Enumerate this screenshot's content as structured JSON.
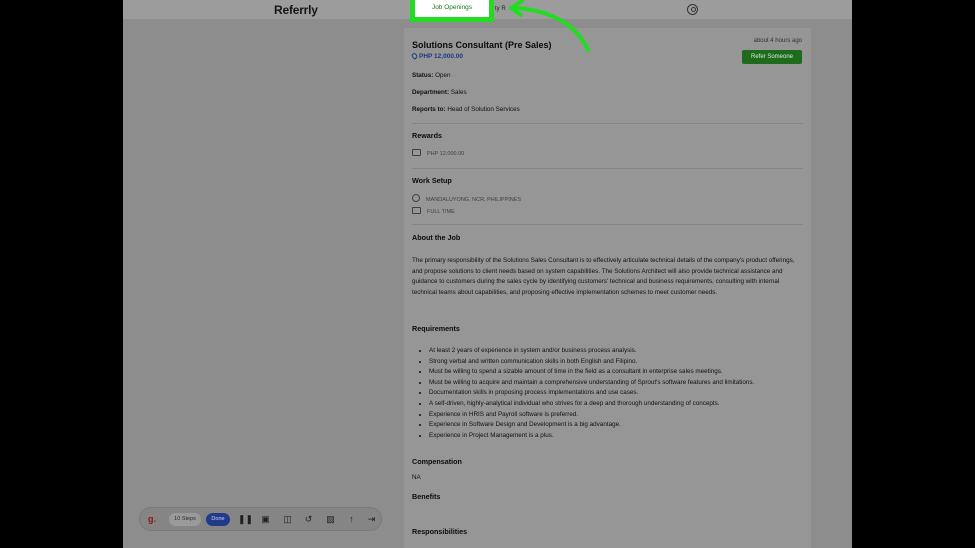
{
  "app": {
    "brand": "Referrly",
    "nav_partial": "ty R"
  },
  "highlight": {
    "label": "Job Openings",
    "color": "#22dc22"
  },
  "job": {
    "posted": "about 4 hours ago",
    "refer_label": "Refer Someone",
    "title": "Solutions Consultant (Pre Sales)",
    "salary": "PHP 12,000.00",
    "status_label": "Status:",
    "status_value": "Open",
    "department_label": "Department:",
    "department_value": "Sales",
    "reports_label": "Reports to:",
    "reports_value": "Head of Solution Services"
  },
  "rewards": {
    "heading": "Rewards",
    "value": "PHP 12,000.00"
  },
  "work_setup": {
    "heading": "Work Setup",
    "location": "MANDALUYONG, NCR, PHILIPPINES",
    "type": "FULL TIME"
  },
  "about": {
    "heading": "About the Job",
    "text": "The primary responsibility of the Solutions Sales Consultant is to effectively articulate technical details of the company's product offerings, and propose solutions to client needs based on system capabilities. The Solutions Architect will also provide technical assistance and guidance to customers during the sales cycle by identifying customers' technical and business requirements, consulting with internal technical teams about capabilities, and proposing effective implementation schemes to meet customer needs."
  },
  "requirements": {
    "heading": "Requirements",
    "items": [
      "At least 2 years of experience in system and/or business process analysis.",
      "Strong verbal and written communication skills in both English and Filipino.",
      "Must be willing to spend a sizable amount of time in the field as a consultant in enterprise sales meetings.",
      "Must be willing to acquire and maintain a comprehensive understanding of Sprout's software features and limitations.",
      "Documentation skills in proposing process implementations and use cases.",
      "A self-driven, highly-analytical individual who strives for a deep and thorough understanding of concepts.",
      "Experience in HRIS and Payroll software is preferred.",
      "Experience in Software Design and Development is a big advantage.",
      "Experience in Project Management is a plus."
    ]
  },
  "compensation": {
    "heading": "Compensation",
    "value": "NA"
  },
  "benefits": {
    "heading": "Benefits"
  },
  "responsibilities": {
    "heading": "Responsibilities"
  },
  "toolbar": {
    "logo": "g.",
    "steps_label": "10 Steps",
    "done_label": "Done",
    "icons": [
      "pause-icon",
      "stop-icon",
      "image-icon",
      "undo-icon",
      "trash-icon",
      "upload-icon",
      "skip-icon"
    ]
  }
}
